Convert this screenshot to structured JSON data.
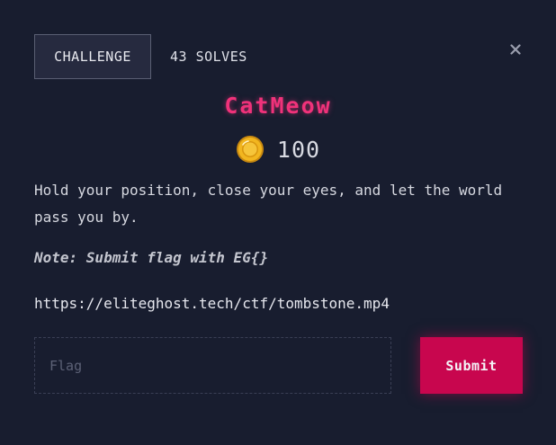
{
  "tabs": {
    "challenge_label": "CHALLENGE",
    "solves_label": "43 SOLVES"
  },
  "modal": {
    "close_icon": "close-icon"
  },
  "challenge": {
    "title": "CatMeow",
    "points": "100",
    "points_icon": "coin-icon",
    "description": "Hold your position, close your eyes, and let the world pass you by.",
    "note": "Note: Submit flag with EG{}",
    "link": "https://eliteghost.tech/ctf/tombstone.mp4"
  },
  "form": {
    "flag_placeholder": "Flag",
    "flag_value": "",
    "submit_label": "Submit"
  },
  "colors": {
    "background": "#181d2f",
    "title": "#f0327a",
    "submit": "#c8064e",
    "coin": "#f2b61f"
  }
}
